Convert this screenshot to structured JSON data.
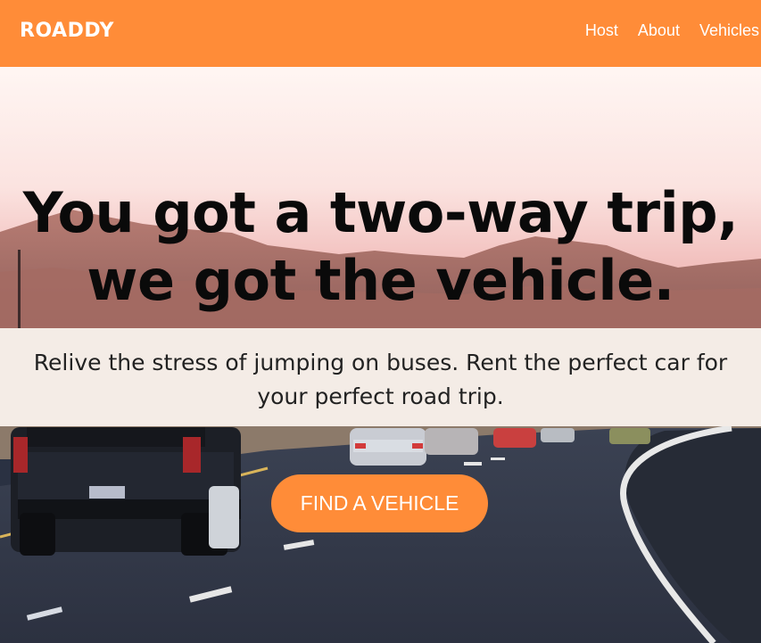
{
  "navbar": {
    "logo": "ROADDY",
    "links": [
      "Host",
      "About",
      "Vehicles"
    ],
    "background_color": "#ff8c38"
  },
  "hero": {
    "headline_line1": "You got a two-way trip,",
    "headline_line2": "we got the vehicle.",
    "subtitle": "Relive the stress of jumping on buses. Rent the perfect car for your perfect road trip.",
    "cta_label": "FIND A VEHICLE",
    "cta_color": "#ff8c38"
  }
}
